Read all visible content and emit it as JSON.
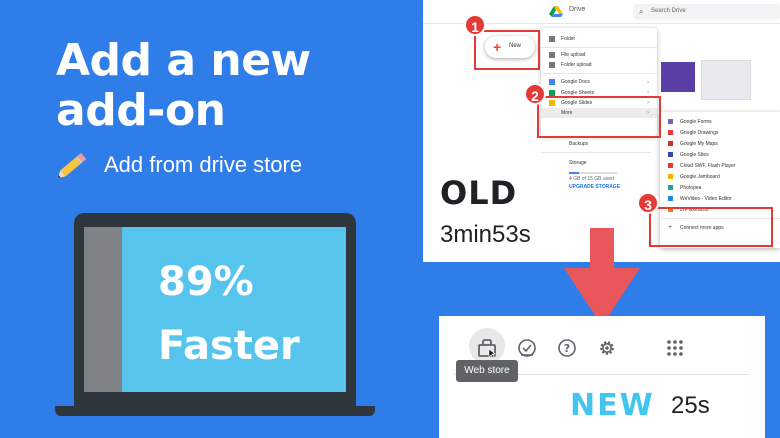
{
  "headline": {
    "line1": "Add a new",
    "line2": "add-on"
  },
  "subtitle": {
    "text": "Add from drive store",
    "icon": "pencil-icon"
  },
  "laptop": {
    "line1": "89%",
    "line2": "Faster"
  },
  "old": {
    "label": "OLD",
    "time": "3min53s",
    "drive": {
      "app_name": "Drive",
      "search_placeholder": "Search Drive",
      "new_button": "New",
      "menu": [
        "Folder",
        "File upload",
        "Folder upload",
        "Google Docs",
        "Google Sheets",
        "Google Slides",
        "More"
      ],
      "side": [
        "Backups",
        "Storage",
        "4 GB of 15 GB used",
        "UPGRADE STORAGE"
      ],
      "submenu": [
        "Google Forms",
        "Google Drawings",
        "Google My Maps",
        "Google Sites",
        "Cloud SWF, Flash Player",
        "Google Jamboard",
        "Photopea",
        "WeVideo - Video Editor",
        "ZIP Extractor",
        "Connect more apps"
      ]
    },
    "steps": [
      "1",
      "2",
      "3"
    ]
  },
  "new": {
    "label": "NEW",
    "time": "25s",
    "tooltip": "Web store",
    "toolbar_icons": [
      "web-store-icon",
      "tasks-icon",
      "help-icon",
      "settings-icon",
      "apps-grid-icon"
    ]
  },
  "colors": {
    "background": "#2f7de9",
    "accent_cyan": "#42c6ef",
    "highlight_red": "#e53935",
    "laptop_screen": "#57c4ee",
    "arrow": "#e9575a"
  }
}
